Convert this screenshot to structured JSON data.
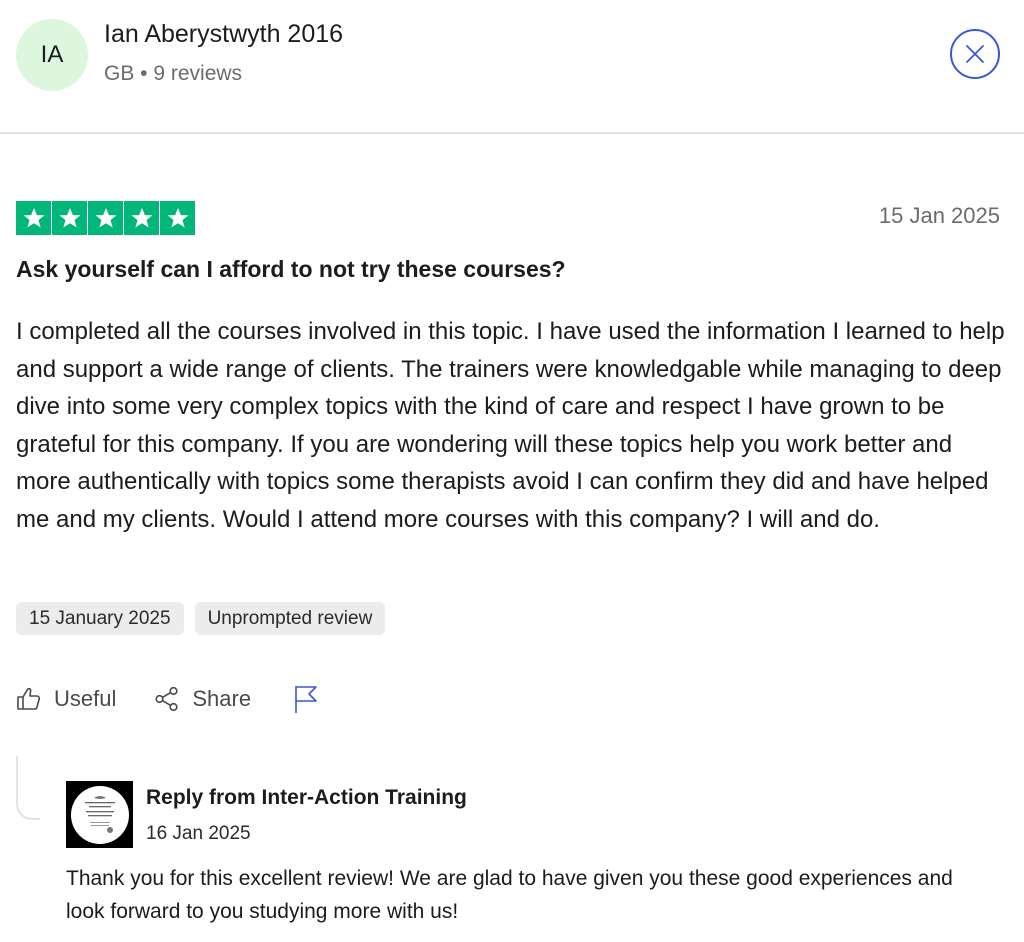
{
  "reviewer": {
    "initials": "IA",
    "name": "Ian Aberystwyth 2016",
    "meta": "GB • 9 reviews"
  },
  "review": {
    "rating": 5,
    "date": "15 Jan 2025",
    "title": "Ask yourself can I afford to not try these courses?",
    "body": "I completed all the courses involved in this topic. I have used the information I learned to help and support a wide range of clients. The trainers were knowledgable while managing to deep dive into some very complex topics with the kind of care and respect I have grown to be grateful for this company. If you are wondering will these topics help you work better and more authentically with topics some therapists avoid I can confirm they did and have helped me and my clients. Would I attend more courses with this company? I will and do.",
    "tags": [
      "15 January 2025",
      "Unprompted review"
    ]
  },
  "actions": {
    "useful_label": "Useful",
    "share_label": "Share"
  },
  "reply": {
    "title": "Reply from Inter-Action Training",
    "date": "16 Jan 2025",
    "body": "Thank you for this excellent review! We are glad to have given you these good experiences and look forward to you studying more with us!"
  },
  "colors": {
    "star_green": "#00b67a",
    "close_blue": "#3c57d6",
    "avatar_bg": "#dcf7dd"
  },
  "icons": [
    "close-icon",
    "star-icon",
    "thumbs-up-icon",
    "share-icon",
    "flag-icon"
  ]
}
